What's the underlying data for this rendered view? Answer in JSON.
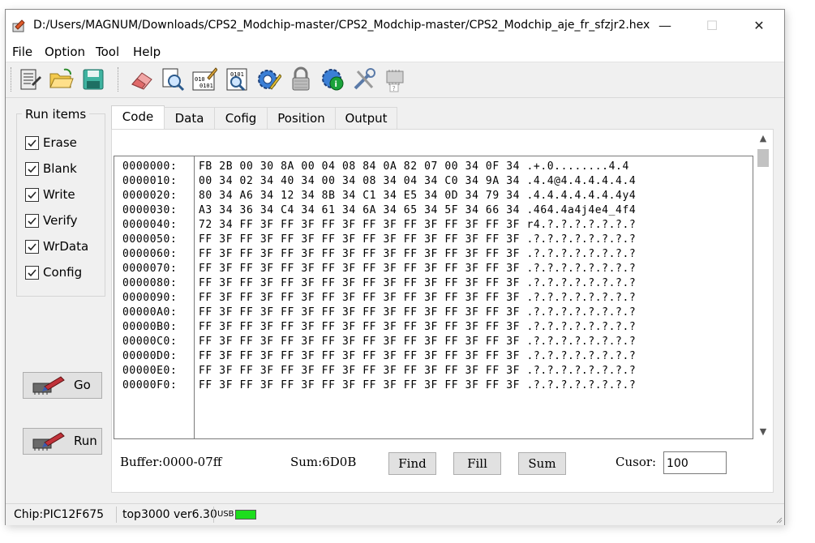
{
  "window": {
    "title": "D:/Users/MAGNUM/Downloads/CPS2_Modchip-master/CPS2_Modchip-master/CPS2_Modchip_aje_fr_sfzjr2.hex",
    "minimize": "—",
    "maximize": "☐",
    "close": "✕"
  },
  "menu": [
    "File",
    "Option",
    "Tool",
    "Help"
  ],
  "toolbar": {
    "icons": [
      "device-read-icon",
      "open-folder-icon",
      "save-disk-icon",
      "eraser-icon",
      "blank-check-icon",
      "write-binary-icon",
      "verify-binary-icon",
      "config-gear-icon",
      "lock-icon",
      "info-gear-icon",
      "test-tools-icon",
      "chip-help-icon"
    ]
  },
  "run_items": {
    "title": "Run items",
    "items": [
      {
        "label": "Erase",
        "checked": true
      },
      {
        "label": "Blank",
        "checked": true
      },
      {
        "label": "Write",
        "checked": true
      },
      {
        "label": "Verify",
        "checked": true
      },
      {
        "label": "WrData",
        "checked": true
      },
      {
        "label": "Config",
        "checked": true
      }
    ]
  },
  "buttons": {
    "go": "Go",
    "run": "Run"
  },
  "tabs": [
    "Code",
    "Data",
    "Cofig",
    "Position",
    "Output"
  ],
  "active_tab": "Code",
  "hex": {
    "addresses": [
      "0000000:",
      "0000010:",
      "0000020:",
      "0000030:",
      "0000040:",
      "0000050:",
      "0000060:",
      "0000070:",
      "0000080:",
      "0000090:",
      "00000A0:",
      "00000B0:",
      "00000C0:",
      "00000D0:",
      "00000E0:",
      "00000F0:"
    ],
    "lines": [
      "FB 2B 00 30 8A 00 04 08 84 0A 82 07 00 34 0F 34 .+.0........4.4",
      "00 34 02 34 40 34 00 34 08 34 04 34 C0 34 9A 34 .4.4@4.4.4.4.4.4",
      "80 34 A6 34 12 34 8B 34 C1 34 E5 34 0D 34 79 34 .4.4.4.4.4.4.4y4",
      "A3 34 36 34 C4 34 61 34 6A 34 65 34 5F 34 66 34 .464.4a4j4e4_4f4",
      "72 34 FF 3F FF 3F FF 3F FF 3F FF 3F FF 3F FF 3F r4.?.?.?.?.?.?.?",
      "FF 3F FF 3F FF 3F FF 3F FF 3F FF 3F FF 3F FF 3F .?.?.?.?.?.?.?.?",
      "FF 3F FF 3F FF 3F FF 3F FF 3F FF 3F FF 3F FF 3F .?.?.?.?.?.?.?.?",
      "FF 3F FF 3F FF 3F FF 3F FF 3F FF 3F FF 3F FF 3F .?.?.?.?.?.?.?.?",
      "FF 3F FF 3F FF 3F FF 3F FF 3F FF 3F FF 3F FF 3F .?.?.?.?.?.?.?.?",
      "FF 3F FF 3F FF 3F FF 3F FF 3F FF 3F FF 3F FF 3F .?.?.?.?.?.?.?.?",
      "FF 3F FF 3F FF 3F FF 3F FF 3F FF 3F FF 3F FF 3F .?.?.?.?.?.?.?.?",
      "FF 3F FF 3F FF 3F FF 3F FF 3F FF 3F FF 3F FF 3F .?.?.?.?.?.?.?.?",
      "FF 3F FF 3F FF 3F FF 3F FF 3F FF 3F FF 3F FF 3F .?.?.?.?.?.?.?.?",
      "FF 3F FF 3F FF 3F FF 3F FF 3F FF 3F FF 3F FF 3F .?.?.?.?.?.?.?.?",
      "FF 3F FF 3F FF 3F FF 3F FF 3F FF 3F FF 3F FF 3F .?.?.?.?.?.?.?.?",
      "FF 3F FF 3F FF 3F FF 3F FF 3F FF 3F FF 3F FF 3F .?.?.?.?.?.?.?.?"
    ]
  },
  "footer": {
    "buffer": "Buffer:0000-07ff",
    "sum": "Sum:6D0B",
    "find": "Find",
    "fill": "Fill",
    "sum_button": "Sum",
    "cursor_label": "Cusor:",
    "cursor_value": "100"
  },
  "status": {
    "chip": "Chip:PIC12F675",
    "version": "top3000 ver6.30",
    "usb": "USB",
    "usb_color": "#1ddd1d"
  }
}
